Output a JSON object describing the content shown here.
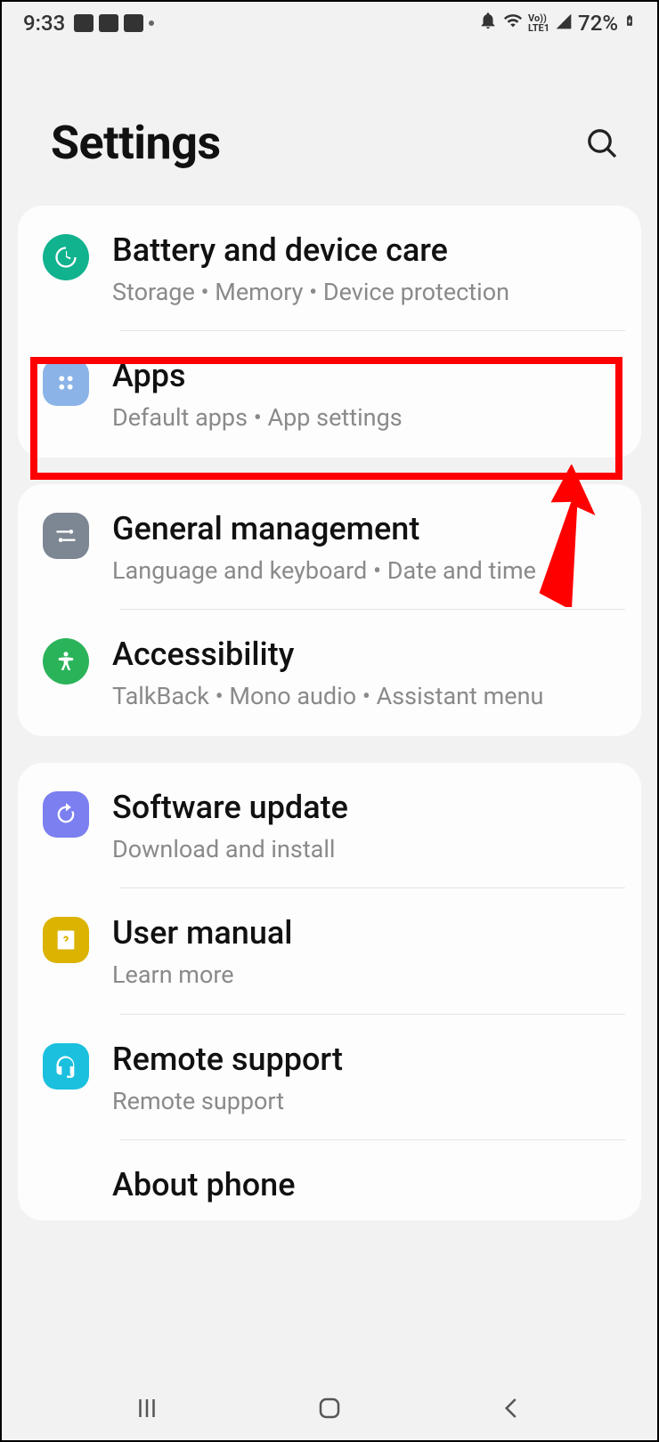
{
  "status": {
    "time": "9:33",
    "battery": "72%",
    "lte_label": "LTE1",
    "vo_label": "Vo))"
  },
  "header": {
    "title": "Settings"
  },
  "groups": [
    {
      "items": [
        {
          "id": "battery-device-care",
          "title": "Battery and device care",
          "subtitle": "Storage  •  Memory  •  Device protection",
          "icon": "device-care-icon",
          "color": "#11b28e",
          "round": true
        },
        {
          "id": "apps",
          "title": "Apps",
          "subtitle": "Default apps  •  App settings",
          "icon": "apps-icon",
          "color": "#8bb3e8",
          "round": false,
          "highlighted": true
        }
      ]
    },
    {
      "items": [
        {
          "id": "general-management",
          "title": "General management",
          "subtitle": "Language and keyboard  •  Date and time",
          "icon": "sliders-icon",
          "color": "#7d8693",
          "round": false
        },
        {
          "id": "accessibility",
          "title": "Accessibility",
          "subtitle": "TalkBack  •  Mono audio  •  Assistant menu",
          "icon": "person-icon",
          "color": "#2bb35a",
          "round": true
        }
      ]
    },
    {
      "items": [
        {
          "id": "software-update",
          "title": "Software update",
          "subtitle": "Download and install",
          "icon": "update-icon",
          "color": "#7b7ff0",
          "round": false
        },
        {
          "id": "user-manual",
          "title": "User manual",
          "subtitle": "Learn more",
          "icon": "manual-icon",
          "color": "#dbb300",
          "round": false
        },
        {
          "id": "remote-support",
          "title": "Remote support",
          "subtitle": "Remote support",
          "icon": "headset-icon",
          "color": "#1bc0de",
          "round": false
        },
        {
          "id": "about-phone",
          "title": "About phone",
          "subtitle": "",
          "icon": "info-icon",
          "color": "#9aa0a6",
          "round": false,
          "partial": true
        }
      ]
    }
  ]
}
